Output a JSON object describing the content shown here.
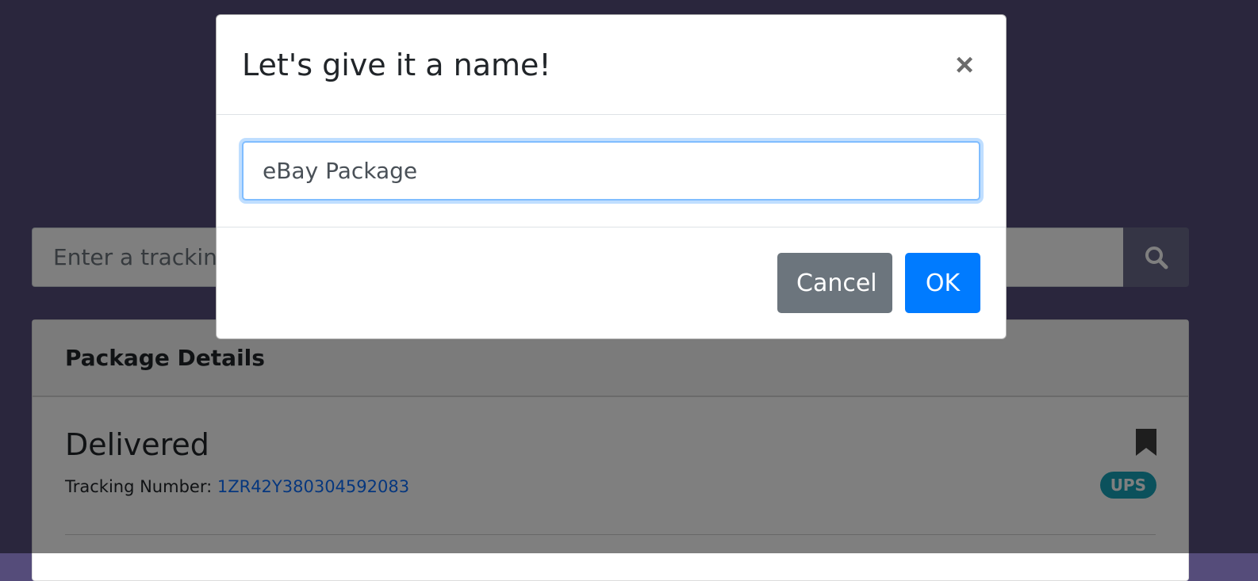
{
  "search": {
    "placeholder": "Enter a tracking number"
  },
  "package_card": {
    "header_title": "Package Details",
    "status": "Delivered",
    "tracking_label": "Tracking Number:",
    "tracking_number": "1ZR42Y380304592083",
    "carrier_badge": "UPS"
  },
  "modal": {
    "title": "Let's give it a name!",
    "close_symbol": "×",
    "name_input_value": "eBay Package",
    "cancel_label": "Cancel",
    "ok_label": "OK"
  },
  "colors": {
    "page_background": "#554c7a",
    "primary": "#007bff",
    "secondary": "#6c757d",
    "badge": "#17a2b8"
  },
  "icons": {
    "search_button": "search-icon",
    "bookmark": "bookmark-icon",
    "close": "close-icon"
  }
}
